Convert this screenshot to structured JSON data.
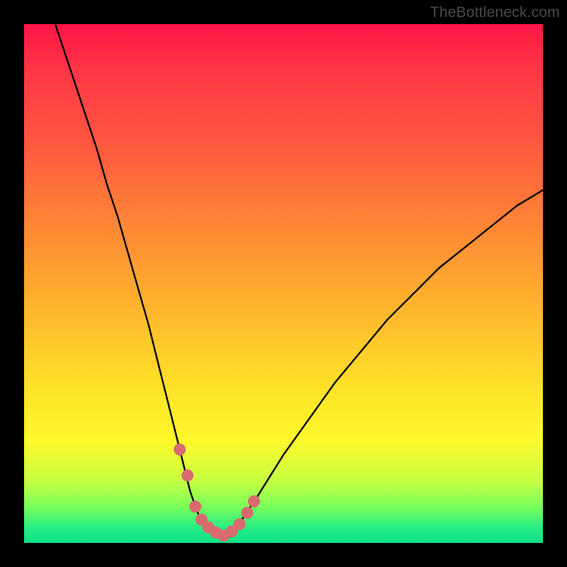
{
  "attribution": "TheBottleneck.com",
  "colors": {
    "page_bg": "#000000",
    "gradient_top": "#ff1547",
    "gradient_mid1": "#ff8a34",
    "gradient_mid2": "#ffe228",
    "gradient_bottom": "#0ee28a",
    "curve_stroke": "#000000",
    "marker_fill": "#d96a6f"
  },
  "chart_data": {
    "type": "line",
    "title": "",
    "xlabel": "",
    "ylabel": "",
    "xlim": [
      0,
      100
    ],
    "ylim": [
      0,
      100
    ],
    "series": [
      {
        "name": "bottleneck-curve",
        "x": [
          6,
          8,
          10,
          12,
          14,
          16,
          18,
          20,
          22,
          24,
          26,
          28,
          30,
          32,
          33,
          34,
          35,
          36,
          37,
          38,
          39,
          40,
          42,
          45,
          50,
          55,
          60,
          65,
          70,
          75,
          80,
          85,
          90,
          95,
          100
        ],
        "values": [
          100,
          94,
          88,
          82,
          76,
          69,
          63,
          56,
          49,
          42,
          34,
          26,
          18,
          10,
          7,
          4.5,
          3,
          2,
          1.4,
          1.2,
          1.5,
          2.2,
          4.5,
          9,
          17,
          24,
          31,
          37,
          43,
          48,
          53,
          57,
          61,
          65,
          68
        ]
      }
    ],
    "markers": {
      "name": "near-minimum-band",
      "x": [
        30,
        31.5,
        33,
        34.2,
        35.5,
        37,
        38.5,
        40,
        41.5,
        43,
        44.3
      ],
      "values": [
        18,
        13,
        7,
        4.5,
        3,
        2,
        1.4,
        2.2,
        3.6,
        5.8,
        8
      ]
    }
  }
}
